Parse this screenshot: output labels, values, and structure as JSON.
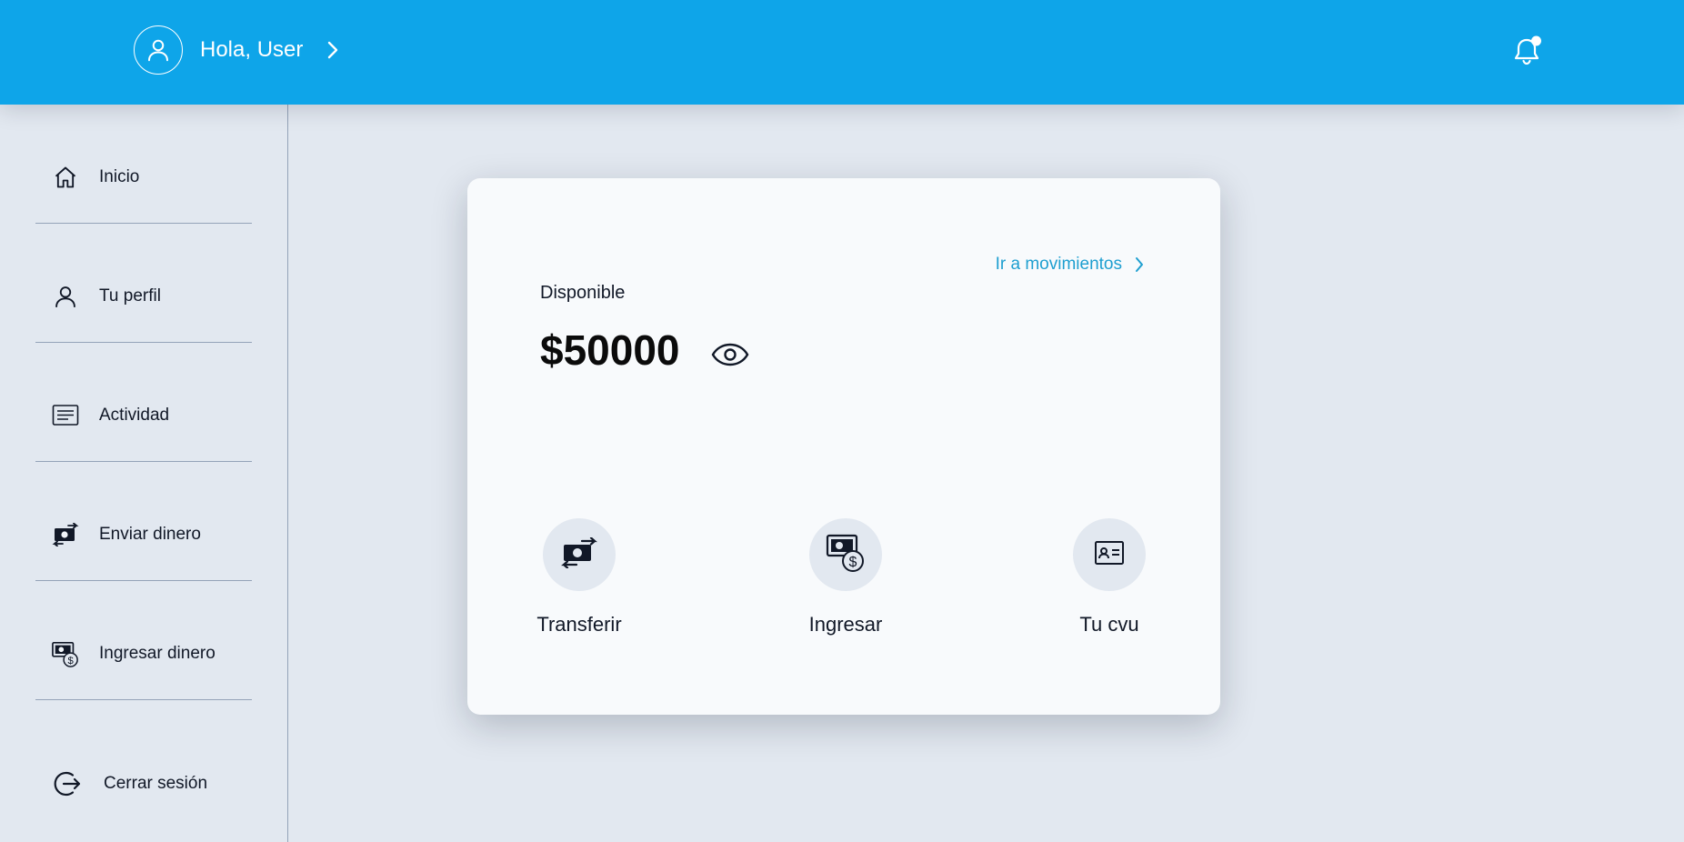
{
  "header": {
    "greeting": "Hola, User",
    "avatar_icon": "user-circle-icon",
    "chevron_icon": "chevron-right-icon",
    "notification_icon": "bell-icon",
    "notification_dot": true,
    "background_color": "#0ea5e9"
  },
  "sidebar": {
    "items": [
      {
        "label": "Inicio",
        "icon": "home-icon"
      },
      {
        "label": "Tu perfil",
        "icon": "user-icon"
      },
      {
        "label": "Actividad",
        "icon": "list-icon"
      },
      {
        "label": "Enviar dinero",
        "icon": "money-transfer-icon"
      },
      {
        "label": "Ingresar dinero",
        "icon": "money-deposit-icon"
      }
    ],
    "logout": {
      "label": "Cerrar sesión",
      "icon": "logout-icon"
    }
  },
  "balance_card": {
    "movements_link": "Ir a movimientos",
    "available_label": "Disponible",
    "balance": "$50000",
    "visibility_icon": "eye-icon",
    "actions": [
      {
        "label": "Transferir",
        "icon": "money-transfer-icon"
      },
      {
        "label": "Ingresar",
        "icon": "money-deposit-icon"
      },
      {
        "label": "Tu cvu",
        "icon": "id-card-icon"
      }
    ]
  }
}
